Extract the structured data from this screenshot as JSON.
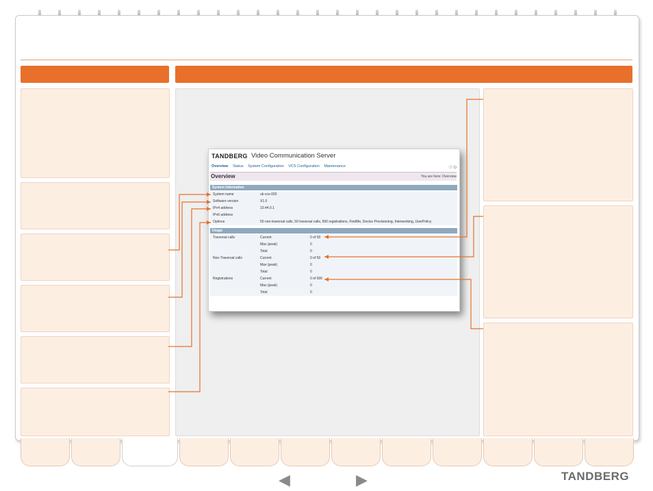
{
  "app": {
    "brand": "TANDBERG",
    "title": "Video Communication Server"
  },
  "menu": [
    {
      "label": "Overview",
      "active": true
    },
    {
      "label": "Status",
      "active": false
    },
    {
      "label": "System Configuration",
      "active": false
    },
    {
      "label": "VCS Configuration",
      "active": false
    },
    {
      "label": "Maintenance",
      "active": false
    }
  ],
  "toolbar": {
    "help_icon": "question-icon",
    "logout_icon": "power-icon"
  },
  "page": {
    "title": "Overview",
    "breadcrumb_prefix": "You are here:",
    "breadcrumb_current": "Overview"
  },
  "system_information": {
    "header": "System Information",
    "rows": [
      {
        "label": "System name",
        "value": "uk-vcs-003"
      },
      {
        "label": "Software version",
        "value": "X1.0"
      },
      {
        "label": "IPv4 address",
        "value": "10.44.0.1"
      },
      {
        "label": "IPv6 address",
        "value": ""
      },
      {
        "label": "Options",
        "value": "50 non-traversal calls, 50 traversal calls, 500 registrations, FindMe, Device Provisioning, Interworking, UserPolicy"
      }
    ]
  },
  "usage": {
    "header": "Usage",
    "rows": [
      {
        "label": "Traversal calls",
        "metric": "Current",
        "value": "0 of 50"
      },
      {
        "label": "",
        "metric": "Max (peak)",
        "value": "0"
      },
      {
        "label": "",
        "metric": "Total",
        "value": "0"
      },
      {
        "label": "Non-Traversal calls",
        "metric": "Current",
        "value": "0 of 50"
      },
      {
        "label": "",
        "metric": "Max (peak)",
        "value": "0"
      },
      {
        "label": "",
        "metric": "Total",
        "value": "0"
      },
      {
        "label": "Registrations",
        "metric": "Current",
        "value": "0 of 500"
      },
      {
        "label": "",
        "metric": "Max (peak)",
        "value": "0"
      },
      {
        "label": "",
        "metric": "Total",
        "value": "0"
      }
    ]
  },
  "footer": {
    "prev_arrow": "◀",
    "next_arrow": "▶",
    "logo": "TANDBERG"
  },
  "colors": {
    "accent": "#e8702a",
    "note_bg": "#fdeee2",
    "section_header": "#8fa9bf",
    "link": "#1d5c94"
  }
}
